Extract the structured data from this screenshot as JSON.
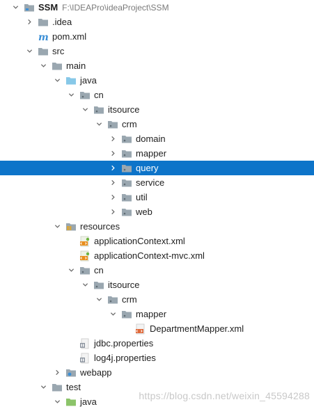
{
  "project_tree": {
    "nodes": [
      {
        "label": "SSM",
        "hint": "F:\\IDEAPro\\ideaProject\\SSM",
        "icon": "project-folder-icon",
        "arrow": "down",
        "selected": false,
        "bold": true
      },
      {
        "label": ".idea",
        "icon": "folder-icon",
        "arrow": "right",
        "selected": false
      },
      {
        "label": "pom.xml",
        "icon": "maven-icon",
        "arrow": "none",
        "selected": false
      },
      {
        "label": "src",
        "icon": "folder-icon",
        "arrow": "down",
        "selected": false
      },
      {
        "label": "main",
        "icon": "folder-icon",
        "arrow": "down",
        "selected": false
      },
      {
        "label": "java",
        "icon": "source-folder-icon",
        "arrow": "down",
        "selected": false
      },
      {
        "label": "cn",
        "icon": "package-icon",
        "arrow": "down",
        "selected": false
      },
      {
        "label": "itsource",
        "icon": "package-icon",
        "arrow": "down",
        "selected": false
      },
      {
        "label": "crm",
        "icon": "package-icon",
        "arrow": "down",
        "selected": false
      },
      {
        "label": "domain",
        "icon": "package-icon",
        "arrow": "right",
        "selected": false
      },
      {
        "label": "mapper",
        "icon": "package-icon",
        "arrow": "right",
        "selected": false
      },
      {
        "label": "query",
        "icon": "package-icon",
        "arrow": "right",
        "selected": true
      },
      {
        "label": "service",
        "icon": "package-icon",
        "arrow": "right",
        "selected": false
      },
      {
        "label": "util",
        "icon": "package-icon",
        "arrow": "right",
        "selected": false
      },
      {
        "label": "web",
        "icon": "package-icon",
        "arrow": "right",
        "selected": false
      },
      {
        "label": "resources",
        "icon": "resources-folder-icon",
        "arrow": "down",
        "selected": false
      },
      {
        "label": "applicationContext.xml",
        "icon": "spring-xml-icon",
        "arrow": "none",
        "selected": false
      },
      {
        "label": "applicationContext-mvc.xml",
        "icon": "spring-xml-icon",
        "arrow": "none",
        "selected": false
      },
      {
        "label": "cn",
        "icon": "package-icon",
        "arrow": "down",
        "selected": false
      },
      {
        "label": "itsource",
        "icon": "package-icon",
        "arrow": "down",
        "selected": false
      },
      {
        "label": "crm",
        "icon": "package-icon",
        "arrow": "down",
        "selected": false
      },
      {
        "label": "mapper",
        "icon": "package-icon",
        "arrow": "down",
        "selected": false
      },
      {
        "label": "DepartmentMapper.xml",
        "icon": "xml-file-icon",
        "arrow": "none",
        "selected": false
      },
      {
        "label": "jdbc.properties",
        "icon": "properties-file-icon",
        "arrow": "none",
        "selected": false
      },
      {
        "label": "log4j.properties",
        "icon": "properties-file-icon",
        "arrow": "none",
        "selected": false
      },
      {
        "label": "webapp",
        "icon": "web-folder-icon",
        "arrow": "right",
        "selected": false
      },
      {
        "label": "test",
        "icon": "folder-icon",
        "arrow": "down",
        "selected": false
      },
      {
        "label": "java",
        "icon": "test-source-folder-icon",
        "arrow": "down",
        "selected": false
      }
    ]
  },
  "watermark": {
    "text": "https://blog.csdn.net/weixin_45594288"
  },
  "colors": {
    "selection": "#0d74c9",
    "folder": "#9aa7b0",
    "source_folder": "#87c8e8",
    "test_folder": "#8cc46a",
    "maven": "#3b8fd6"
  }
}
